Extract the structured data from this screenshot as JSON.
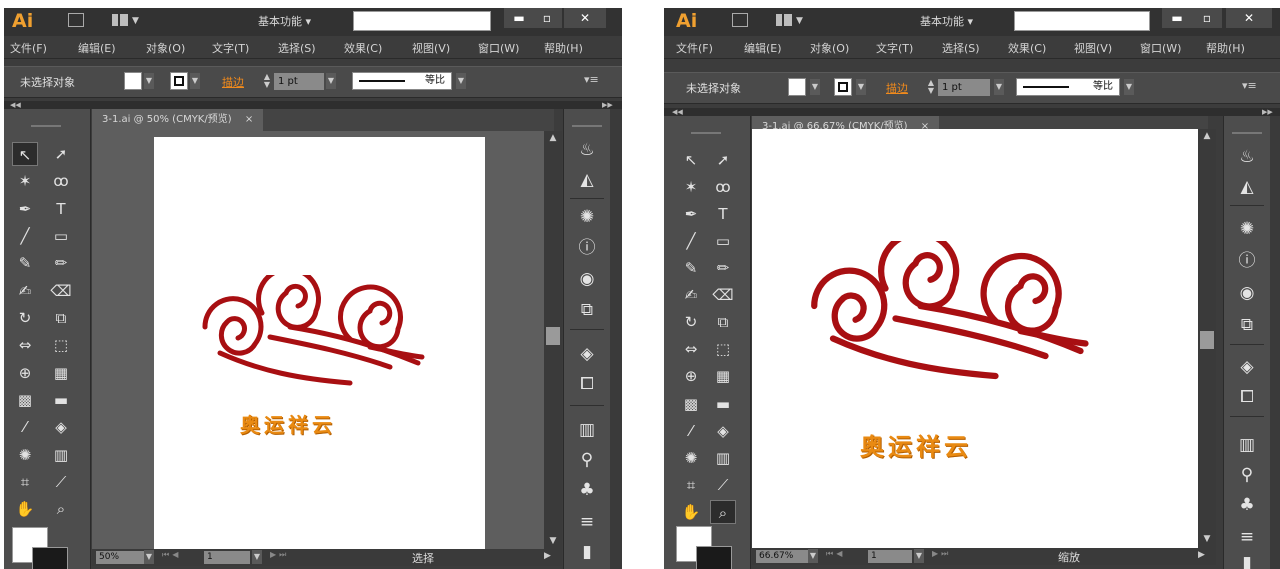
{
  "app": {
    "logo": "Ai",
    "workspace": "基本功能 ▾"
  },
  "window_buttons": {
    "minimize": "▬",
    "restore": "▫",
    "close": "✕"
  },
  "menu": [
    "文件(F)",
    "编辑(E)",
    "对象(O)",
    "文字(T)",
    "选择(S)",
    "效果(C)",
    "视图(V)",
    "窗口(W)",
    "帮助(H)"
  ],
  "control_bar": {
    "selection_status": "未选择对象",
    "stroke_label": "描边",
    "stroke_weight": "1 pt",
    "profile_label": "等比",
    "panel_menu": "▾≡"
  },
  "windows": [
    {
      "tab_label": "3-1.ai @ 50% (CMYK/预览)",
      "tab_close": "×",
      "zoom": "50%",
      "page": "1",
      "status": "选择",
      "logo_text": "奥运祥云"
    },
    {
      "tab_label": "3-1.ai @ 66.67% (CMYK/预览)",
      "tab_close": "×",
      "zoom": "66.67%",
      "page": "1",
      "status": "缩放",
      "logo_text": "奥运祥云"
    }
  ],
  "tools": [
    "selection-tool",
    "direct-selection-tool",
    "magic-wand-tool",
    "lasso-tool",
    "pen-tool",
    "type-tool",
    "line-segment-tool",
    "rectangle-tool",
    "paintbrush-tool",
    "pencil-tool",
    "blob-brush-tool",
    "eraser-tool",
    "rotate-tool",
    "scale-tool",
    "width-tool",
    "free-transform-tool",
    "shape-builder-tool",
    "perspective-grid-tool",
    "mesh-tool",
    "gradient-tool",
    "eyedropper-tool",
    "blend-tool",
    "symbol-sprayer-tool",
    "column-graph-tool",
    "artboard-tool",
    "slice-tool",
    "hand-tool",
    "zoom-tool"
  ],
  "dock_icons": [
    "color-guide-icon",
    "appearance-icon",
    "color-icon",
    "info-icon",
    "transparency-icon",
    "transform-icon",
    "layers-icon",
    "artboards-icon",
    "align-icon",
    "symbols-icon",
    "club-symbol-icon",
    "stroke-panel-icon"
  ],
  "colors": {
    "logo_red": "#a80f12",
    "logo_text": "#e98a12",
    "ui_bg": "#3c3c3c",
    "accent_orange": "#f08a1c"
  }
}
